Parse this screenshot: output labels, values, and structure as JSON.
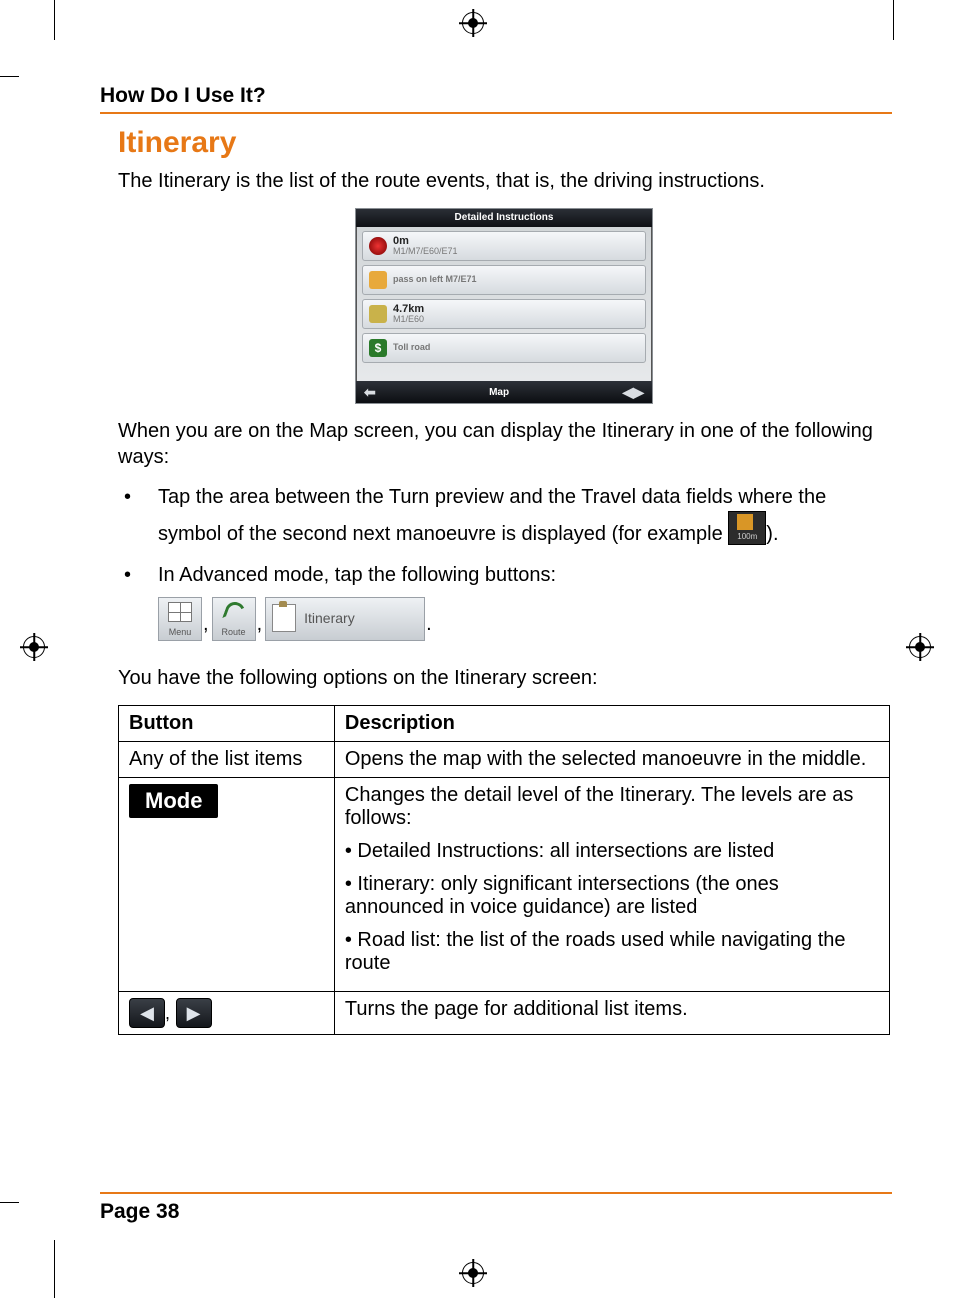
{
  "header": {
    "section": "How Do I Use It?"
  },
  "title": "Itinerary",
  "intro": "The Itinerary is the list of the route events, that is, the driving instructions.",
  "screenshot": {
    "header": "Detailed Instructions",
    "rows": [
      {
        "line1": "0m",
        "line2": "M1/M7/E60/E71",
        "icon": "start-icon"
      },
      {
        "line1": "pass on left M7/E71",
        "line2": "",
        "icon": "left-icon"
      },
      {
        "line1": "4.7km",
        "line2": "M1/E60",
        "icon": "merge-icon"
      },
      {
        "line1": "Toll road",
        "line2": "",
        "icon": "toll-icon"
      }
    ],
    "footer_label": "Map"
  },
  "para2": "When you are on the Map screen, you can display the Itinerary in one of the following ways:",
  "bullets": {
    "b1_a": "Tap the area between the Turn preview and the Travel data fields where the symbol of the second next manoeuvre is displayed (for example ",
    "b1_icon_dist": "100m",
    "b1_b": ").",
    "b2": "In Advanced mode, tap the following buttons:"
  },
  "buttons": {
    "menu": "Menu",
    "route": "Route",
    "itinerary": "Itinerary"
  },
  "para3": "You have the following options on the Itinerary screen:",
  "table": {
    "head_button": "Button",
    "head_desc": "Description",
    "row1_btn": "Any of the list items",
    "row1_desc": "Opens the map with the selected manoeuvre in the middle.",
    "row2_btn": "Mode",
    "row2_desc": "Changes the detail level of the Itinerary. The levels are as follows:",
    "row2_li1": "• Detailed Instructions: all intersections are listed",
    "row2_li2": "• Itinerary: only significant intersections (the ones announced in voice guidance) are listed",
    "row2_li3": "• Road list: the list of the roads used while navigating the route",
    "row3_desc": "Turns the page for additional list items."
  },
  "footer": {
    "page": "Page 38"
  }
}
